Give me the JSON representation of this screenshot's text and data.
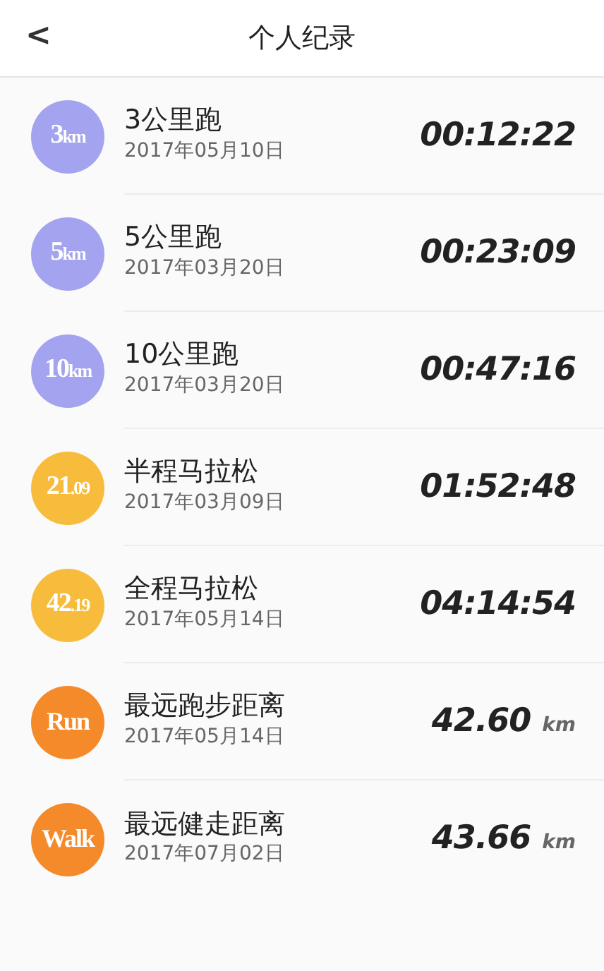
{
  "header": {
    "back": "<",
    "title": "个人纪录"
  },
  "records": [
    {
      "badge_main": "3",
      "badge_sub": "km",
      "color": "#a3a3ef",
      "name": "3公里跑",
      "date": "2017年05月10日",
      "value": "00:12:22"
    },
    {
      "badge_main": "5",
      "badge_sub": "km",
      "color": "#a3a3ef",
      "name": "5公里跑",
      "date": "2017年03月20日",
      "value": "00:23:09"
    },
    {
      "badge_main": "10",
      "badge_sub": "km",
      "color": "#a3a3ef",
      "name": "10公里跑",
      "date": "2017年03月20日",
      "value": "00:47:16"
    },
    {
      "badge_main": "21",
      "badge_sub": ".09",
      "color": "#f7bc3c",
      "name": "半程马拉松",
      "date": "2017年03月09日",
      "value": "01:52:48"
    },
    {
      "badge_main": "42",
      "badge_sub": ".19",
      "color": "#f7bc3c",
      "name": "全程马拉松",
      "date": "2017年05月14日",
      "value": "04:14:54"
    },
    {
      "badge_main": "Run",
      "color": "#f58a2a",
      "name": "最远跑步距离",
      "date": "2017年05月14日",
      "value": "42.60",
      "unit": "km"
    },
    {
      "badge_main": "Walk",
      "color": "#f58a2a",
      "name": "最远健走距离",
      "date": "2017年07月02日",
      "value": "43.66",
      "unit": "km"
    }
  ]
}
